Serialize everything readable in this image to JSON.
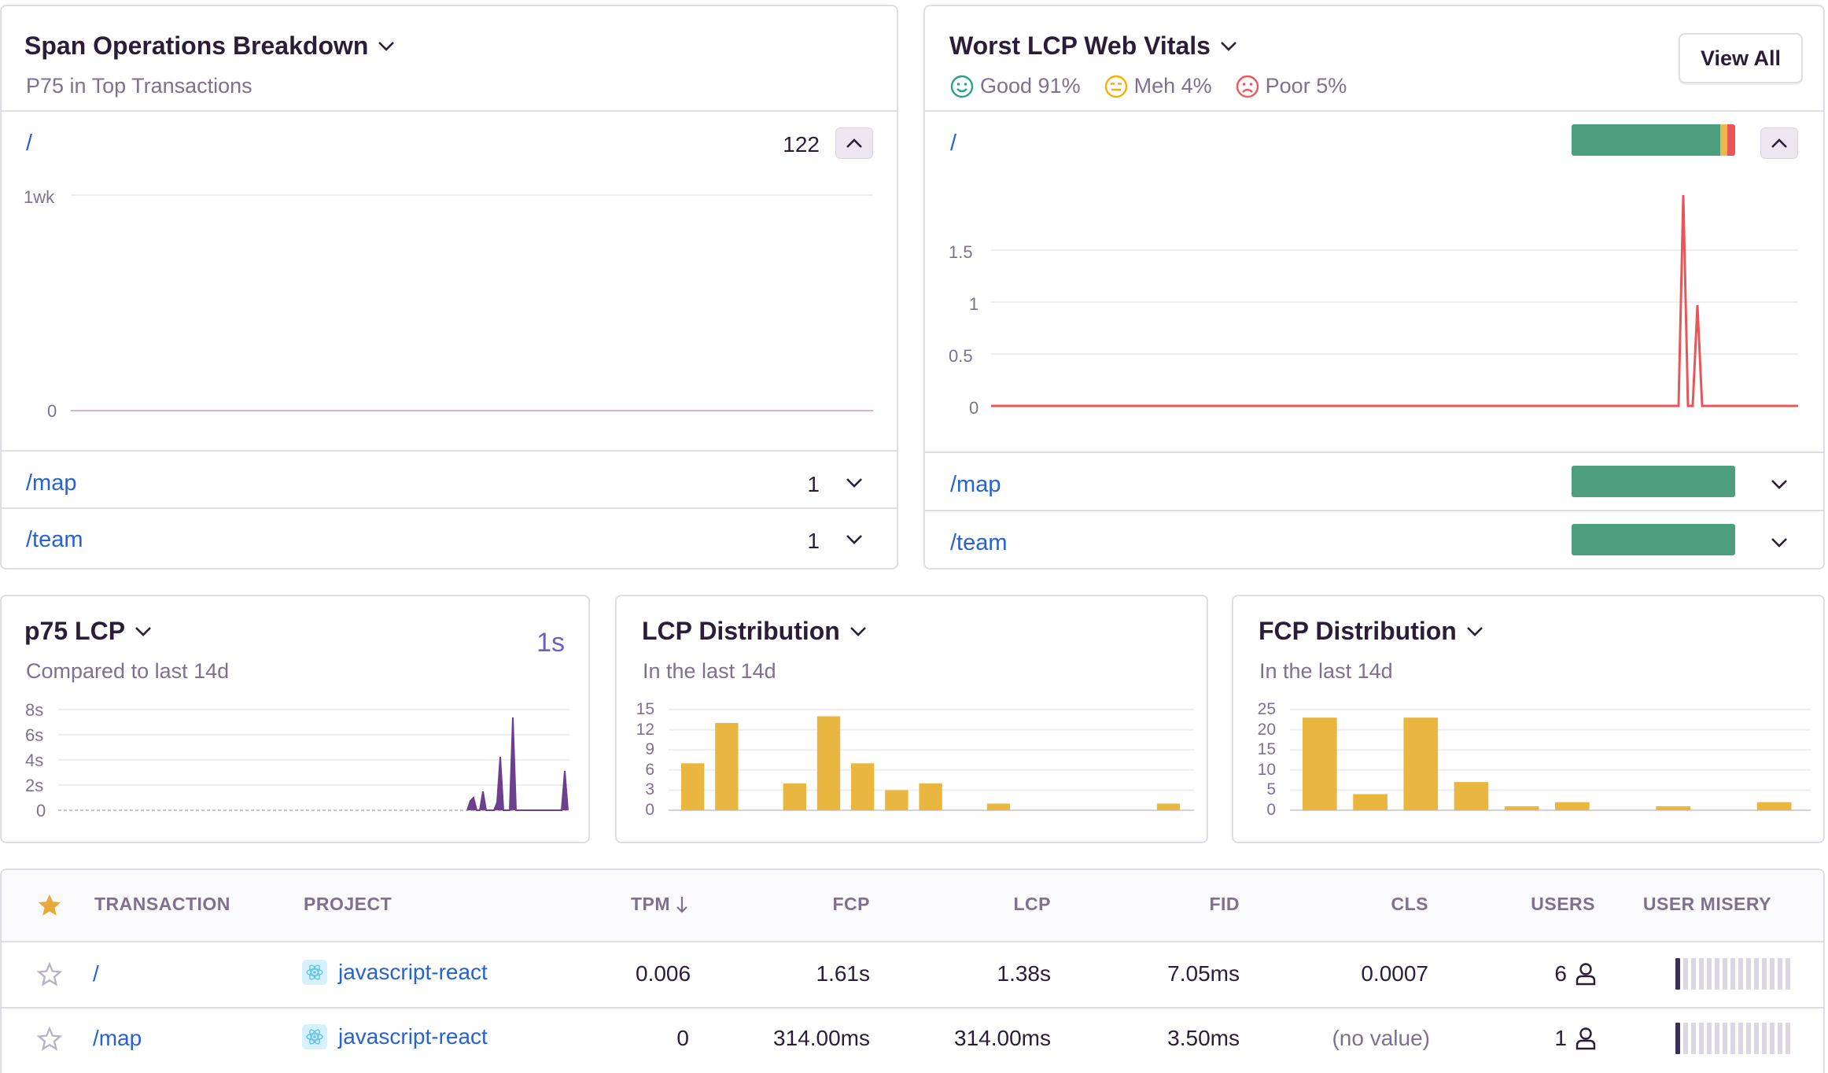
{
  "span_panel": {
    "title": "Span Operations Breakdown",
    "subtitle": "P75 in Top Transactions",
    "rows": [
      {
        "path": "/",
        "count": "122"
      },
      {
        "path": "/map",
        "count": "1"
      },
      {
        "path": "/team",
        "count": "1"
      }
    ],
    "y_ticks": [
      "1wk",
      "0"
    ]
  },
  "lcp_panel": {
    "title": "Worst LCP Web Vitals",
    "legend": [
      {
        "label": "Good 91%",
        "color": "#2ba185"
      },
      {
        "label": "Meh 4%",
        "color": "#f5b000"
      },
      {
        "label": "Poor 5%",
        "color": "#f55459"
      }
    ],
    "view_all": "View All",
    "rows": [
      {
        "path": "/",
        "good": 91,
        "meh": 4,
        "poor": 5
      },
      {
        "path": "/map",
        "good": 100,
        "meh": 0,
        "poor": 0
      },
      {
        "path": "/team",
        "good": 100,
        "meh": 0,
        "poor": 0
      }
    ],
    "y_ticks": [
      "1.5",
      "1",
      "0.5",
      "0"
    ]
  },
  "p75_panel": {
    "title": "p75 LCP",
    "subtitle": "Compared to last 14d",
    "value": "1s",
    "y_ticks": [
      "8s",
      "6s",
      "4s",
      "2s",
      "0"
    ]
  },
  "lcp_dist": {
    "title": "LCP Distribution",
    "subtitle": "In the last 14d",
    "y_ticks": [
      "15",
      "12",
      "9",
      "6",
      "3",
      "0"
    ]
  },
  "fcp_dist": {
    "title": "FCP Distribution",
    "subtitle": "In the last 14d",
    "y_ticks": [
      "25",
      "20",
      "15",
      "10",
      "5",
      "0"
    ]
  },
  "colors": {
    "good": "#4d9e7f",
    "meh": "#e9b949",
    "poor": "#e8565a",
    "purple": "#6c3f8f",
    "bar": "#e9b63f",
    "link": "#2562d4"
  },
  "table": {
    "headers": {
      "transaction": "TRANSACTION",
      "project": "PROJECT",
      "tpm": "TPM",
      "fcp": "FCP",
      "lcp": "LCP",
      "fid": "FID",
      "cls": "CLS",
      "users": "USERS",
      "misery": "USER MISERY"
    },
    "rows": [
      {
        "transaction": "/",
        "project": "javascript-react",
        "tpm": "0.006",
        "fcp": "1.61s",
        "lcp": "1.38s",
        "fid": "7.05ms",
        "cls": "0.0007",
        "users": "6"
      },
      {
        "transaction": "/map",
        "project": "javascript-react",
        "tpm": "0",
        "fcp": "314.00ms",
        "lcp": "314.00ms",
        "fid": "3.50ms",
        "cls": "(no value)",
        "users": "1"
      }
    ]
  },
  "chart_data": [
    {
      "type": "line",
      "series": [
        {
          "values": [
            0,
            0,
            0,
            0,
            0,
            0,
            0,
            0,
            0,
            0
          ]
        }
      ],
      "ylim": [
        0,
        1
      ]
    },
    {
      "type": "line",
      "series": [
        {
          "values": [
            0,
            0,
            0,
            0,
            0,
            0,
            0,
            0,
            0,
            0,
            0,
            0,
            0,
            0,
            0,
            0,
            0,
            0,
            0,
            0,
            0,
            0,
            0,
            0,
            0,
            0,
            0,
            0,
            0,
            0,
            0,
            0,
            0,
            0,
            0,
            0,
            0,
            0,
            0,
            0,
            0,
            0,
            0,
            0,
            0,
            0,
            0,
            0,
            0,
            0,
            0,
            0,
            0,
            0,
            0,
            0,
            0,
            0,
            0,
            0,
            0,
            0,
            0,
            0,
            0,
            0,
            0,
            0,
            0,
            0,
            0,
            0,
            0,
            0,
            0,
            0,
            0,
            0,
            0,
            0,
            0,
            0,
            0,
            0,
            2,
            0,
            1,
            0,
            0,
            0,
            0,
            0,
            0,
            0,
            0,
            0,
            0,
            0,
            0,
            0
          ]
        }
      ],
      "ylim": [
        0,
        2
      ]
    },
    {
      "type": "area",
      "series": [
        {
          "values": [
            0,
            0,
            0,
            0,
            0,
            0,
            0,
            0,
            0,
            0,
            0,
            0,
            0,
            0,
            0,
            0,
            0,
            0,
            0,
            0,
            0,
            0,
            0,
            0,
            0,
            0,
            0,
            0,
            0,
            0,
            0,
            0,
            0,
            0,
            0,
            0,
            0,
            0,
            0,
            0,
            0,
            0,
            0,
            0,
            0,
            0,
            0,
            0,
            0,
            0,
            0,
            0,
            0,
            0,
            0,
            0,
            0,
            0,
            0,
            0,
            0,
            0,
            0,
            0,
            0,
            0,
            0,
            0,
            0,
            0,
            0,
            0,
            0,
            0,
            1.4,
            1.6,
            0,
            0,
            0,
            4.3,
            0,
            7.5,
            0,
            0,
            0,
            0,
            0,
            0,
            0,
            0,
            0,
            0,
            0,
            0,
            0,
            0,
            0,
            3.8
          ]
        }
      ],
      "ylim": [
        0,
        8
      ]
    },
    {
      "type": "bar",
      "values": [
        7,
        13,
        0,
        4,
        14,
        7,
        3,
        4,
        0,
        1,
        0,
        0,
        0,
        0,
        1
      ],
      "ylim": [
        0,
        15
      ]
    },
    {
      "type": "bar",
      "values": [
        23,
        4,
        23,
        7,
        1,
        2,
        0,
        1,
        0,
        2
      ],
      "ylim": [
        0,
        25
      ]
    }
  ]
}
